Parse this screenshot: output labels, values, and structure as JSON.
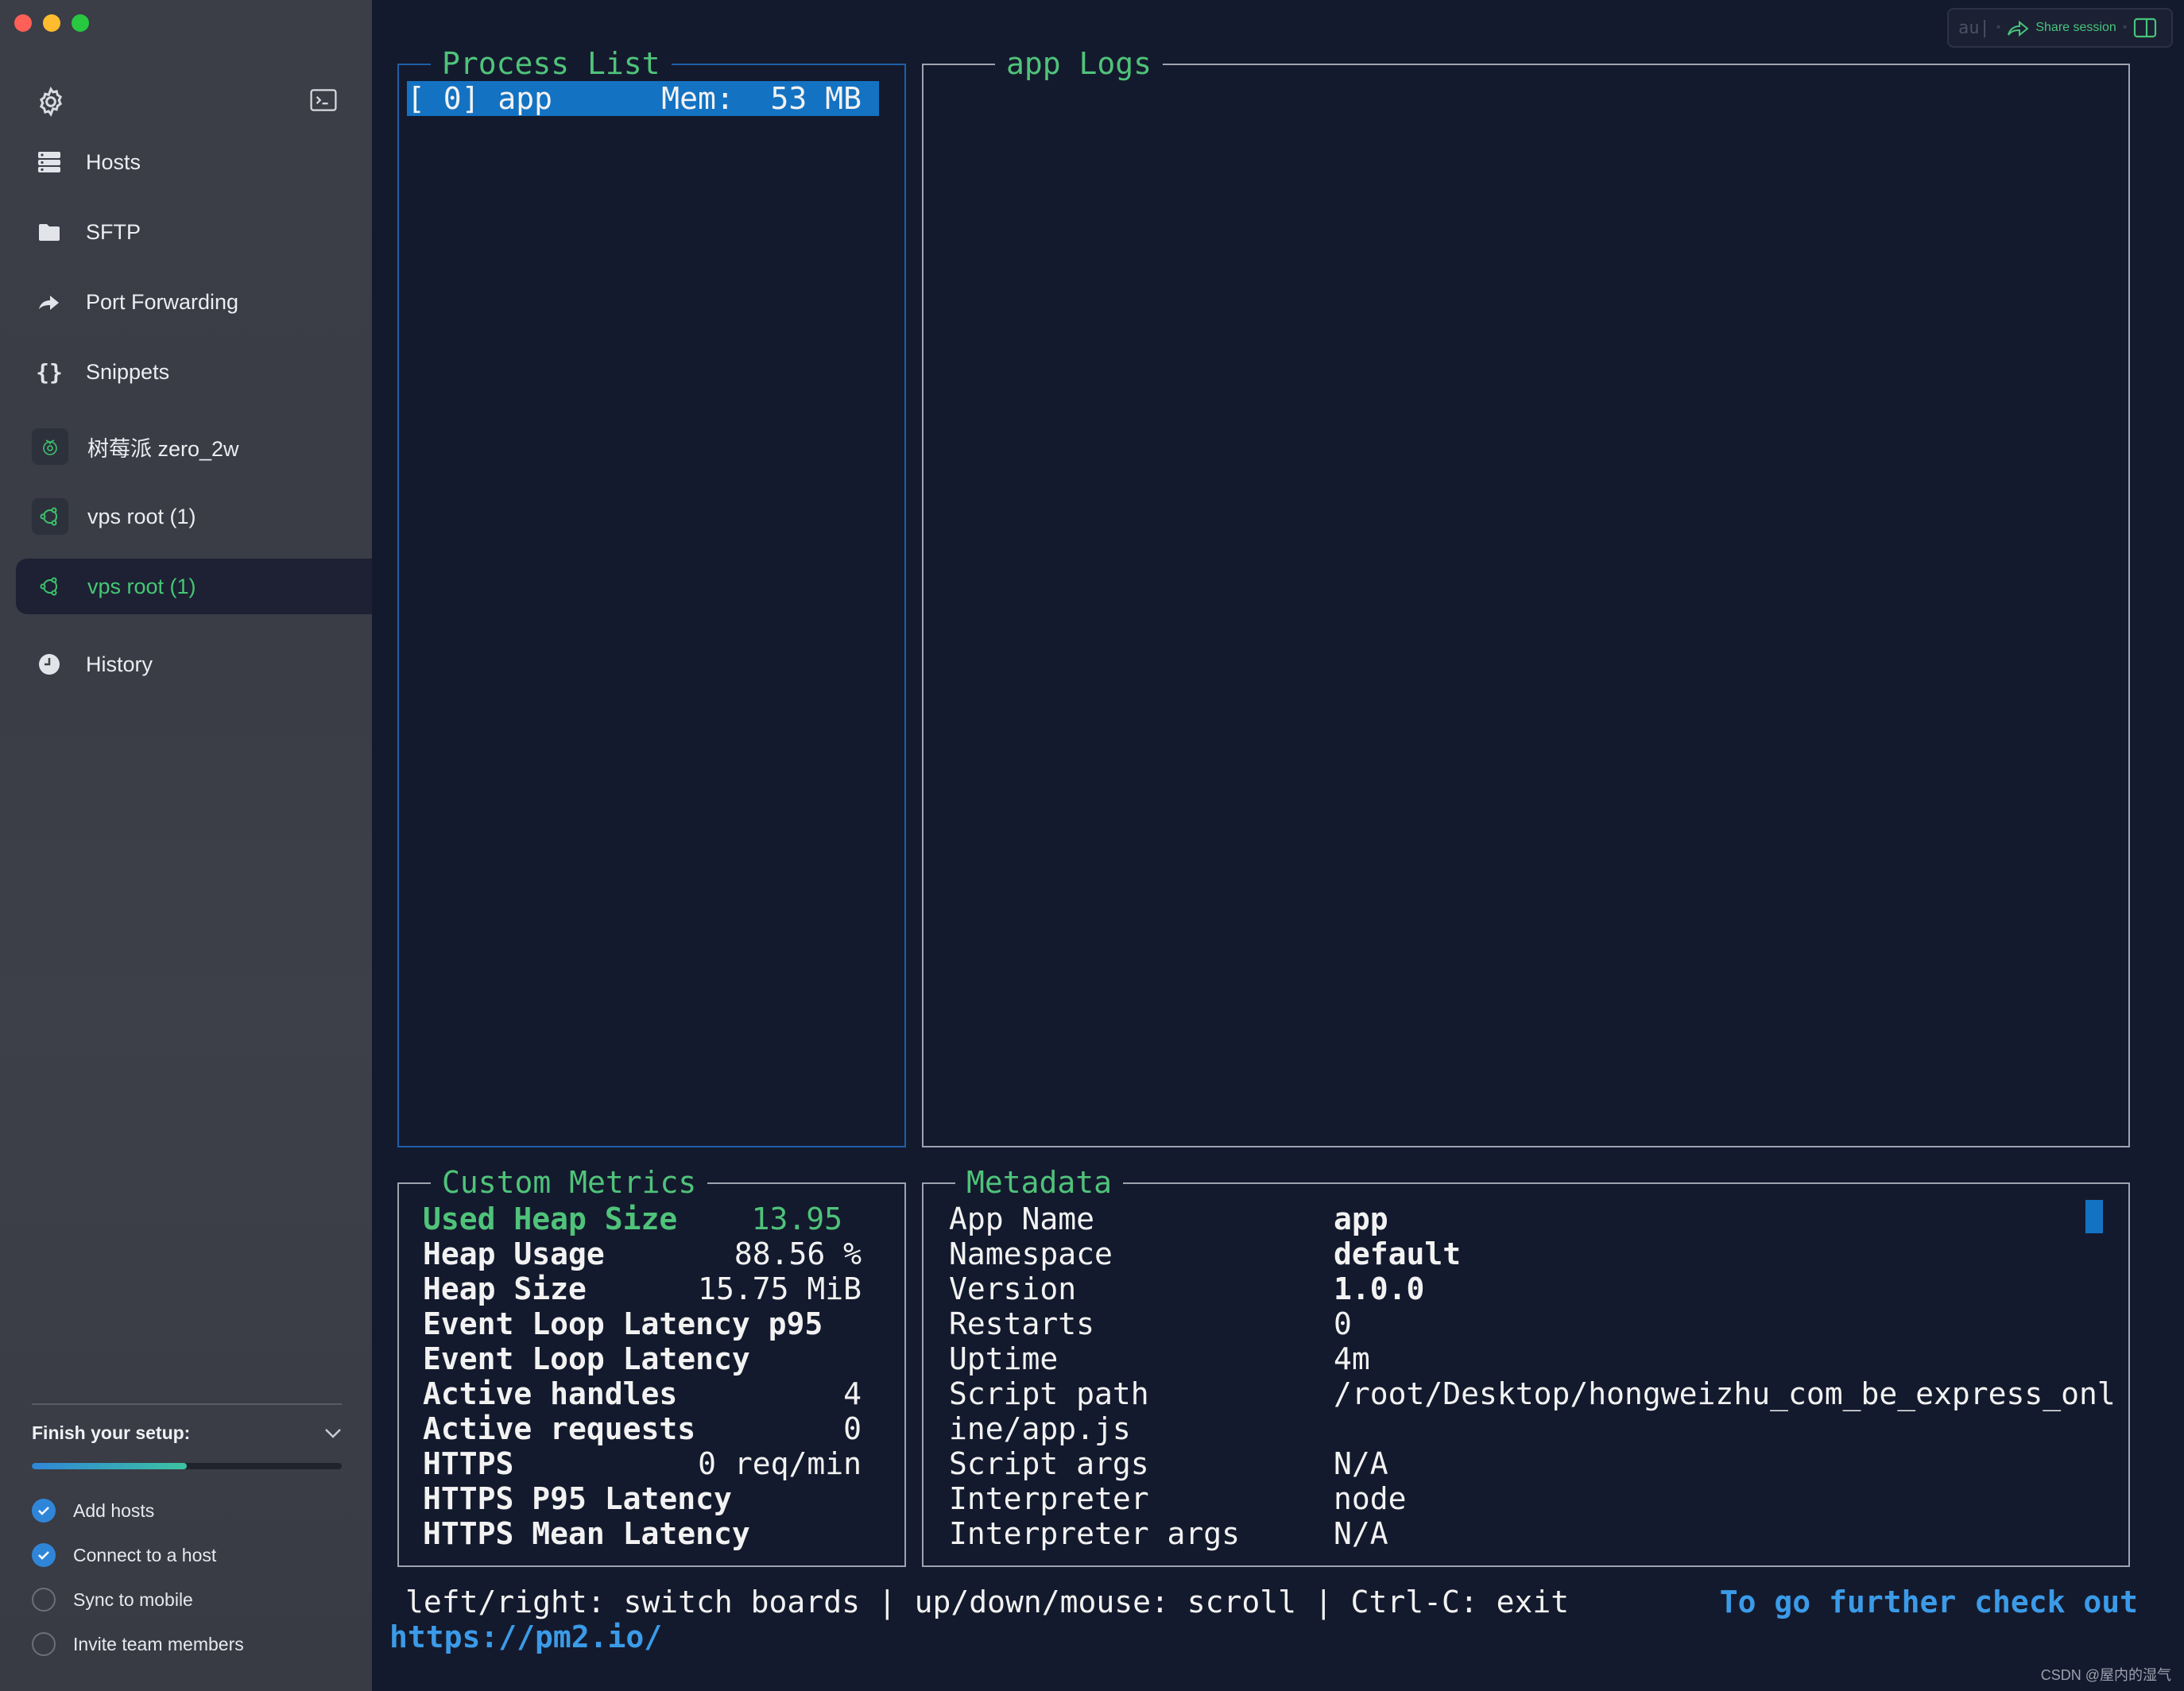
{
  "sidebar": {
    "nav": [
      {
        "label": "Hosts",
        "icon": "hosts-icon"
      },
      {
        "label": "SFTP",
        "icon": "folder-icon"
      },
      {
        "label": "Port Forwarding",
        "icon": "port-forwarding-icon"
      },
      {
        "label": "Snippets",
        "icon": "snippets-icon"
      }
    ],
    "hosts": [
      {
        "label": "树莓派 zero_2w",
        "icon": "raspberry-pi-icon"
      },
      {
        "label": "vps root (1)",
        "icon": "ubuntu-icon"
      },
      {
        "label": "vps root (1)",
        "icon": "ubuntu-icon",
        "active": true
      }
    ],
    "history": {
      "label": "History",
      "icon": "history-icon"
    },
    "setup": {
      "title": "Finish your setup:",
      "progress": 0.5,
      "tasks": [
        {
          "label": "Add hosts",
          "done": true
        },
        {
          "label": "Connect to a host",
          "done": true
        },
        {
          "label": "Sync to mobile",
          "done": false
        },
        {
          "label": "Invite team members",
          "done": false
        }
      ]
    }
  },
  "toolbar": {
    "input_value": "au|",
    "share_label": "Share session"
  },
  "terminal": {
    "process_list": {
      "title": "Process List",
      "rows": [
        "[ 0] app      Mem:  53 MB"
      ]
    },
    "logs": {
      "title": "app Logs"
    },
    "custom_metrics": {
      "title": "Custom Metrics",
      "rows": [
        {
          "name": "Used Heap Size",
          "value": "13.95"
        },
        {
          "name": "Heap Usage",
          "value": "88.56 %"
        },
        {
          "name": "Heap Size",
          "value": "15.75 MiB"
        },
        {
          "name": "Event Loop Latency p95",
          "value": ""
        },
        {
          "name": "Event Loop Latency",
          "value": ""
        },
        {
          "name": "Active handles",
          "value": "4"
        },
        {
          "name": "Active requests",
          "value": "0"
        },
        {
          "name": "HTTPS",
          "value": "0 req/min"
        },
        {
          "name": "HTTPS P95 Latency",
          "value": ""
        },
        {
          "name": "HTTPS Mean Latency",
          "value": ""
        }
      ]
    },
    "metadata": {
      "title": "Metadata",
      "rows": [
        {
          "key": "App Name",
          "value": "app"
        },
        {
          "key": "Namespace",
          "value": "default"
        },
        {
          "key": "Version",
          "value": "1.0.0"
        },
        {
          "key": "Restarts",
          "value": "0"
        },
        {
          "key": "Uptime",
          "value": "4m"
        },
        {
          "key": "Script path",
          "value": "/root/Desktop/hongweizhu_com_be_express_onl"
        },
        {
          "key": "ine/app.js",
          "value": ""
        },
        {
          "key": "Script args",
          "value": "N/A"
        },
        {
          "key": "Interpreter",
          "value": "node"
        },
        {
          "key": "Interpreter args",
          "value": "N/A"
        }
      ]
    },
    "help": "left/right: switch boards | up/down/mouse: scroll | Ctrl-C: exit",
    "further": "To go further check out",
    "url": "https://pm2.io/"
  },
  "watermark": "CSDN @屋内的湿气",
  "colors": {
    "accent_green": "#4fc37a",
    "selection_blue": "#1472c2",
    "link_blue": "#3b9be8"
  }
}
